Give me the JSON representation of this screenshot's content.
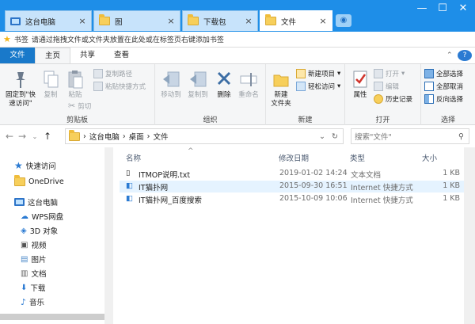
{
  "tabs": [
    {
      "label": "这台电脑",
      "icon": "computer-icon"
    },
    {
      "label": "图",
      "icon": "folder-icon"
    },
    {
      "label": "下载包",
      "icon": "folder-icon"
    },
    {
      "label": "文件",
      "icon": "folder-icon"
    }
  ],
  "window_controls": {
    "min": "—",
    "max": "☐",
    "close": "✕"
  },
  "bookmark": {
    "label": "书签",
    "hint": "请通过拖拽文件或文件夹放置在此处或在标签页右键添加书签"
  },
  "ribbon_tabs": [
    "文件",
    "主页",
    "共享",
    "查看"
  ],
  "ribbon": {
    "clipboard": {
      "group": "剪贴板",
      "pin": "固定到\"快速访问\"",
      "copy": "复制",
      "paste": "粘贴",
      "copy_path": "复制路径",
      "paste_shortcut": "粘贴快捷方式",
      "cut": "剪切"
    },
    "organize": {
      "group": "组织",
      "move_to": "移动到",
      "copy_to": "复制到",
      "delete": "删除",
      "rename": "重命名"
    },
    "new": {
      "group": "新建",
      "new_folder": "新建\n文件夹",
      "new_item": "新建项目",
      "easy_access": "轻松访问"
    },
    "open": {
      "group": "打开",
      "properties": "属性",
      "open": "打开",
      "edit": "编辑",
      "history": "历史记录"
    },
    "select": {
      "group": "选择",
      "select_all": "全部选择",
      "select_none": "全部取消",
      "invert": "反向选择"
    }
  },
  "address": {
    "crumbs": [
      "这台电脑",
      "桌面",
      "文件"
    ],
    "search_placeholder": "搜索\"文件\""
  },
  "navpane": {
    "items": [
      "快速访问",
      "OneDrive",
      "这台电脑",
      "WPS网盘",
      "3D 对象",
      "视频",
      "图片",
      "文档",
      "下载",
      "音乐"
    ]
  },
  "columns": {
    "name": "名称",
    "modified": "修改日期",
    "type": "类型",
    "size": "大小"
  },
  "files": [
    {
      "name": "ITMOP说明.txt",
      "date": "2019-01-02 14:24",
      "type": "文本文档",
      "size": "1 KB"
    },
    {
      "name": "IT猫扑网",
      "date": "2015-09-30 16:51",
      "type": "Internet 快捷方式",
      "size": "1 KB"
    },
    {
      "name": "IT猫扑网_百度搜索",
      "date": "2015-10-09 10:06",
      "type": "Internet 快捷方式",
      "size": "1 KB"
    }
  ]
}
